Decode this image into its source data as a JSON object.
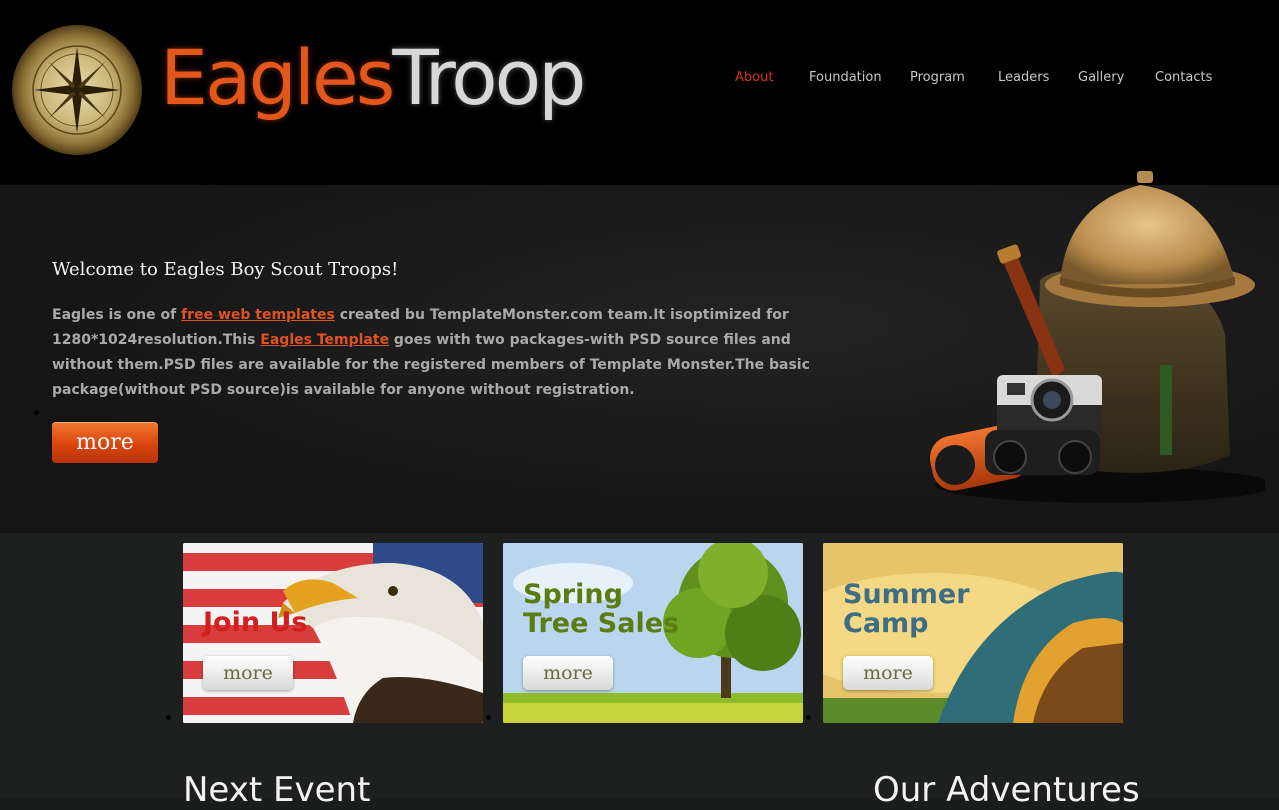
{
  "header": {
    "logo_part1": "Eagles",
    "logo_part2": "Troop",
    "nav": [
      {
        "label": "About",
        "active": true
      },
      {
        "label": "Foundation",
        "active": false
      },
      {
        "label": "Program",
        "active": false
      },
      {
        "label": "Leaders",
        "active": false
      },
      {
        "label": "Gallery",
        "active": false
      },
      {
        "label": "Contacts",
        "active": false
      }
    ]
  },
  "hero": {
    "title": "Welcome to Eagles Boy Scout Troops!",
    "text_1": "Eagles is one of ",
    "link_1": "free web templates",
    "text_2": " created bu TemplateMonster.com team.It isoptimized for 1280*1024resolution.This ",
    "link_2": "Eagles Template",
    "text_3": " goes with two packages-with PSD source files and without them.PSD files are available for the registered members of Template Monster.The basic package(without PSD source)is available for anyone without registration.",
    "more_label": "more"
  },
  "banners": [
    {
      "title_line1": "Join Us",
      "title_line2": "",
      "more_label": "more",
      "title_color": "#d21f1f"
    },
    {
      "title_line1": "Spring",
      "title_line2": "Tree Sales",
      "more_label": "more",
      "title_color": "#5a7d12"
    },
    {
      "title_line1": "Summer",
      "title_line2": "Camp",
      "more_label": "more",
      "title_color": "#3d6e86"
    }
  ],
  "sections": {
    "next_event": "Next Event",
    "our_adventures": "Our Adventures"
  },
  "colors": {
    "accent": "#e05320",
    "nav_active": "#d4351c"
  },
  "icons": [
    "compass-icon"
  ]
}
